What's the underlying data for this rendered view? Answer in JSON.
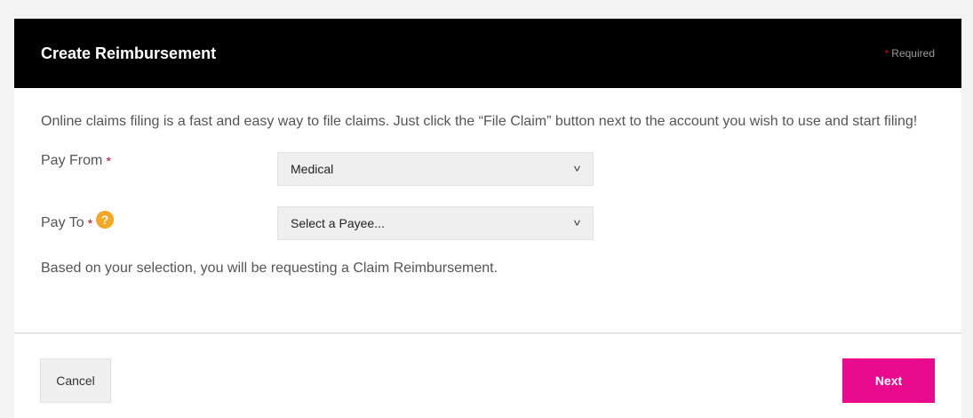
{
  "header": {
    "title": "Create Reimbursement",
    "required_star": "*",
    "required_text": "Required"
  },
  "intro_text": "Online claims filing is a fast and easy way to file claims. Just click the “File Claim” button next to the account you wish to use and start filing!",
  "pay_from": {
    "label": "Pay From",
    "star": "*",
    "selected": "Medical"
  },
  "pay_to": {
    "label": "Pay To",
    "star": "*",
    "help_glyph": "?",
    "selected": "Select a Payee..."
  },
  "chevron_glyph": "˅",
  "selection_note": "Based on your selection, you will be requesting a Claim Reimbursement.",
  "footer": {
    "cancel_label": "Cancel",
    "next_label": "Next"
  },
  "colors": {
    "header_bg": "#000000",
    "accent": "#ea0a8e",
    "required": "#d0021b",
    "help": "#f5a623"
  }
}
